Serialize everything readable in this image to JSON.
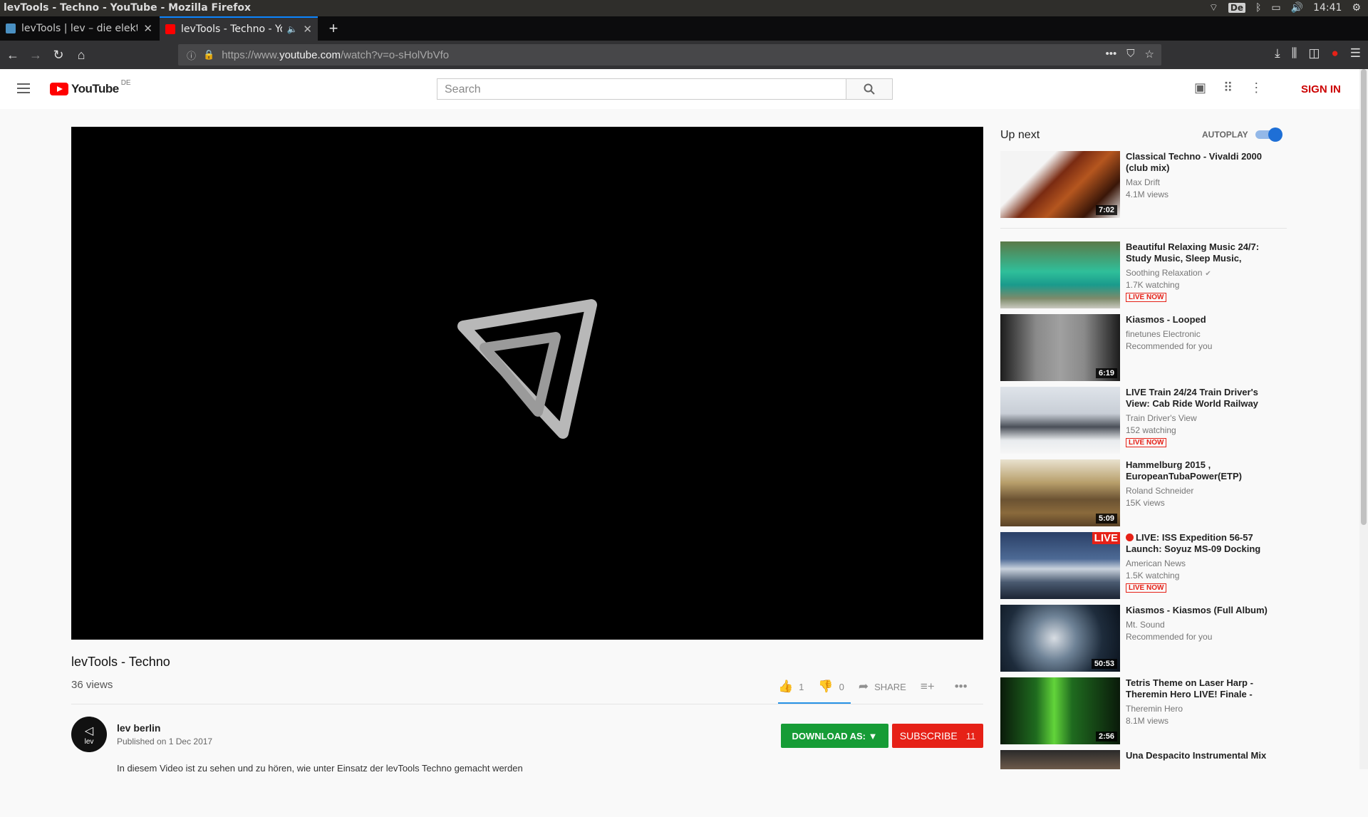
{
  "os": {
    "window_title": "levTools - Techno - YouTube - Mozilla Firefox",
    "keyboard": "De",
    "clock": "14:41"
  },
  "browser": {
    "tabs": [
      {
        "label": "levTools | lev – die elekt",
        "active": false
      },
      {
        "label": "levTools - Techno - Yo",
        "active": true
      }
    ],
    "url_prefix": "https://www.",
    "url_host": "youtube.com",
    "url_path": "/watch?v=o-sHolVbVfo"
  },
  "youtube": {
    "logo_text": "YouTube",
    "country": "DE",
    "search_placeholder": "Search",
    "sign_in": "SIGN IN"
  },
  "video": {
    "title": "levTools - Techno",
    "views": "36 views",
    "likes": "1",
    "dislikes": "0",
    "share": "SHARE",
    "channel": "lev berlin",
    "avatar_text": "lev",
    "published": "Published on 1 Dec 2017",
    "description": "In diesem Video ist zu sehen und zu hören, wie unter Einsatz der levTools Techno gemacht werden",
    "download_label": "DOWNLOAD AS: ▼",
    "subscribe_label": "SUBSCRIBE",
    "subscriber_count": "11"
  },
  "sidebar": {
    "up_next": "Up next",
    "autoplay": "AUTOPLAY",
    "autoplay_on": true,
    "videos": [
      {
        "title": "Classical Techno - Vivaldi 2000 (club mix)",
        "channel": "Max Drift",
        "meta": "4.1M views",
        "duration": "7:02"
      },
      {
        "title": "Beautiful Relaxing Music 24/7: Study Music, Sleep Music,",
        "channel": "Soothing Relaxation",
        "meta": "1.7K watching",
        "live": "LIVE NOW"
      },
      {
        "title": "Kiasmos - Looped",
        "channel": "finetunes Electronic",
        "meta": "Recommended for you",
        "duration": "6:19"
      },
      {
        "title": "LIVE Train 24/24 Train Driver's View: Cab Ride World Railway",
        "channel": "Train Driver's View",
        "meta": "152 watching",
        "live": "LIVE NOW"
      },
      {
        "title": "Hammelburg 2015 , EuropeanTubaPower(ETP)",
        "channel": "Roland Schneider",
        "meta": "15K views",
        "duration": "5:09"
      },
      {
        "title": "LIVE: ISS Expedition 56-57 Launch: Soyuz MS-09 Docking",
        "channel": "American News",
        "meta": "1.5K watching",
        "live": "LIVE NOW",
        "thumb_label": "LIVE"
      },
      {
        "title": "Kiasmos - Kiasmos (Full Album)",
        "channel": "Mt. Sound",
        "meta": "Recommended for you",
        "duration": "50:53"
      },
      {
        "title": "Tetris Theme on Laser Harp - Theremin Hero LIVE! Finale -",
        "channel": "Theremin Hero",
        "meta": "8.1M views",
        "duration": "2:56"
      },
      {
        "title": "Una Despacito Instrumental Mix",
        "channel": "",
        "meta": ""
      }
    ]
  },
  "colors": {
    "youtube_red": "#ff0000",
    "subscribe_red": "#e62117",
    "download_green": "#169c36",
    "firefox_blue": "#0a84ff"
  }
}
